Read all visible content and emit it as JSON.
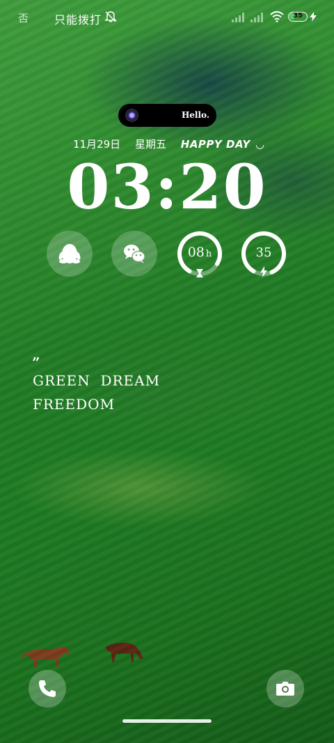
{
  "status_bar": {
    "left_glyph": "否",
    "carrier_text": "只能拨打",
    "battery_level": "35",
    "battery_color": "#5bd15b"
  },
  "dynamic_island": {
    "text": "Hello."
  },
  "lock_screen": {
    "date": "11月29日",
    "weekday": "星期五",
    "greeting": "HAPPY DAY",
    "greeting_emoticon": "◡",
    "time": "03:20",
    "widgets": [
      {
        "icon": "qq-penguin-icon"
      },
      {
        "icon": "wechat-icon"
      },
      {
        "value": "08",
        "unit": "h",
        "icon": "hourglass-icon",
        "progress_fraction": 0.75
      },
      {
        "value": "35",
        "icon": "charging-bolt-icon",
        "progress_fraction": 0.85
      }
    ],
    "quote_mark": "”",
    "quote_line1": "GREEN  DREAM",
    "quote_line2": "FREEDOM"
  },
  "shortcuts": {
    "left_icon": "phone-icon",
    "right_icon": "camera-icon"
  },
  "colors": {
    "accent": "#ffffff",
    "grass": "#207a24"
  }
}
